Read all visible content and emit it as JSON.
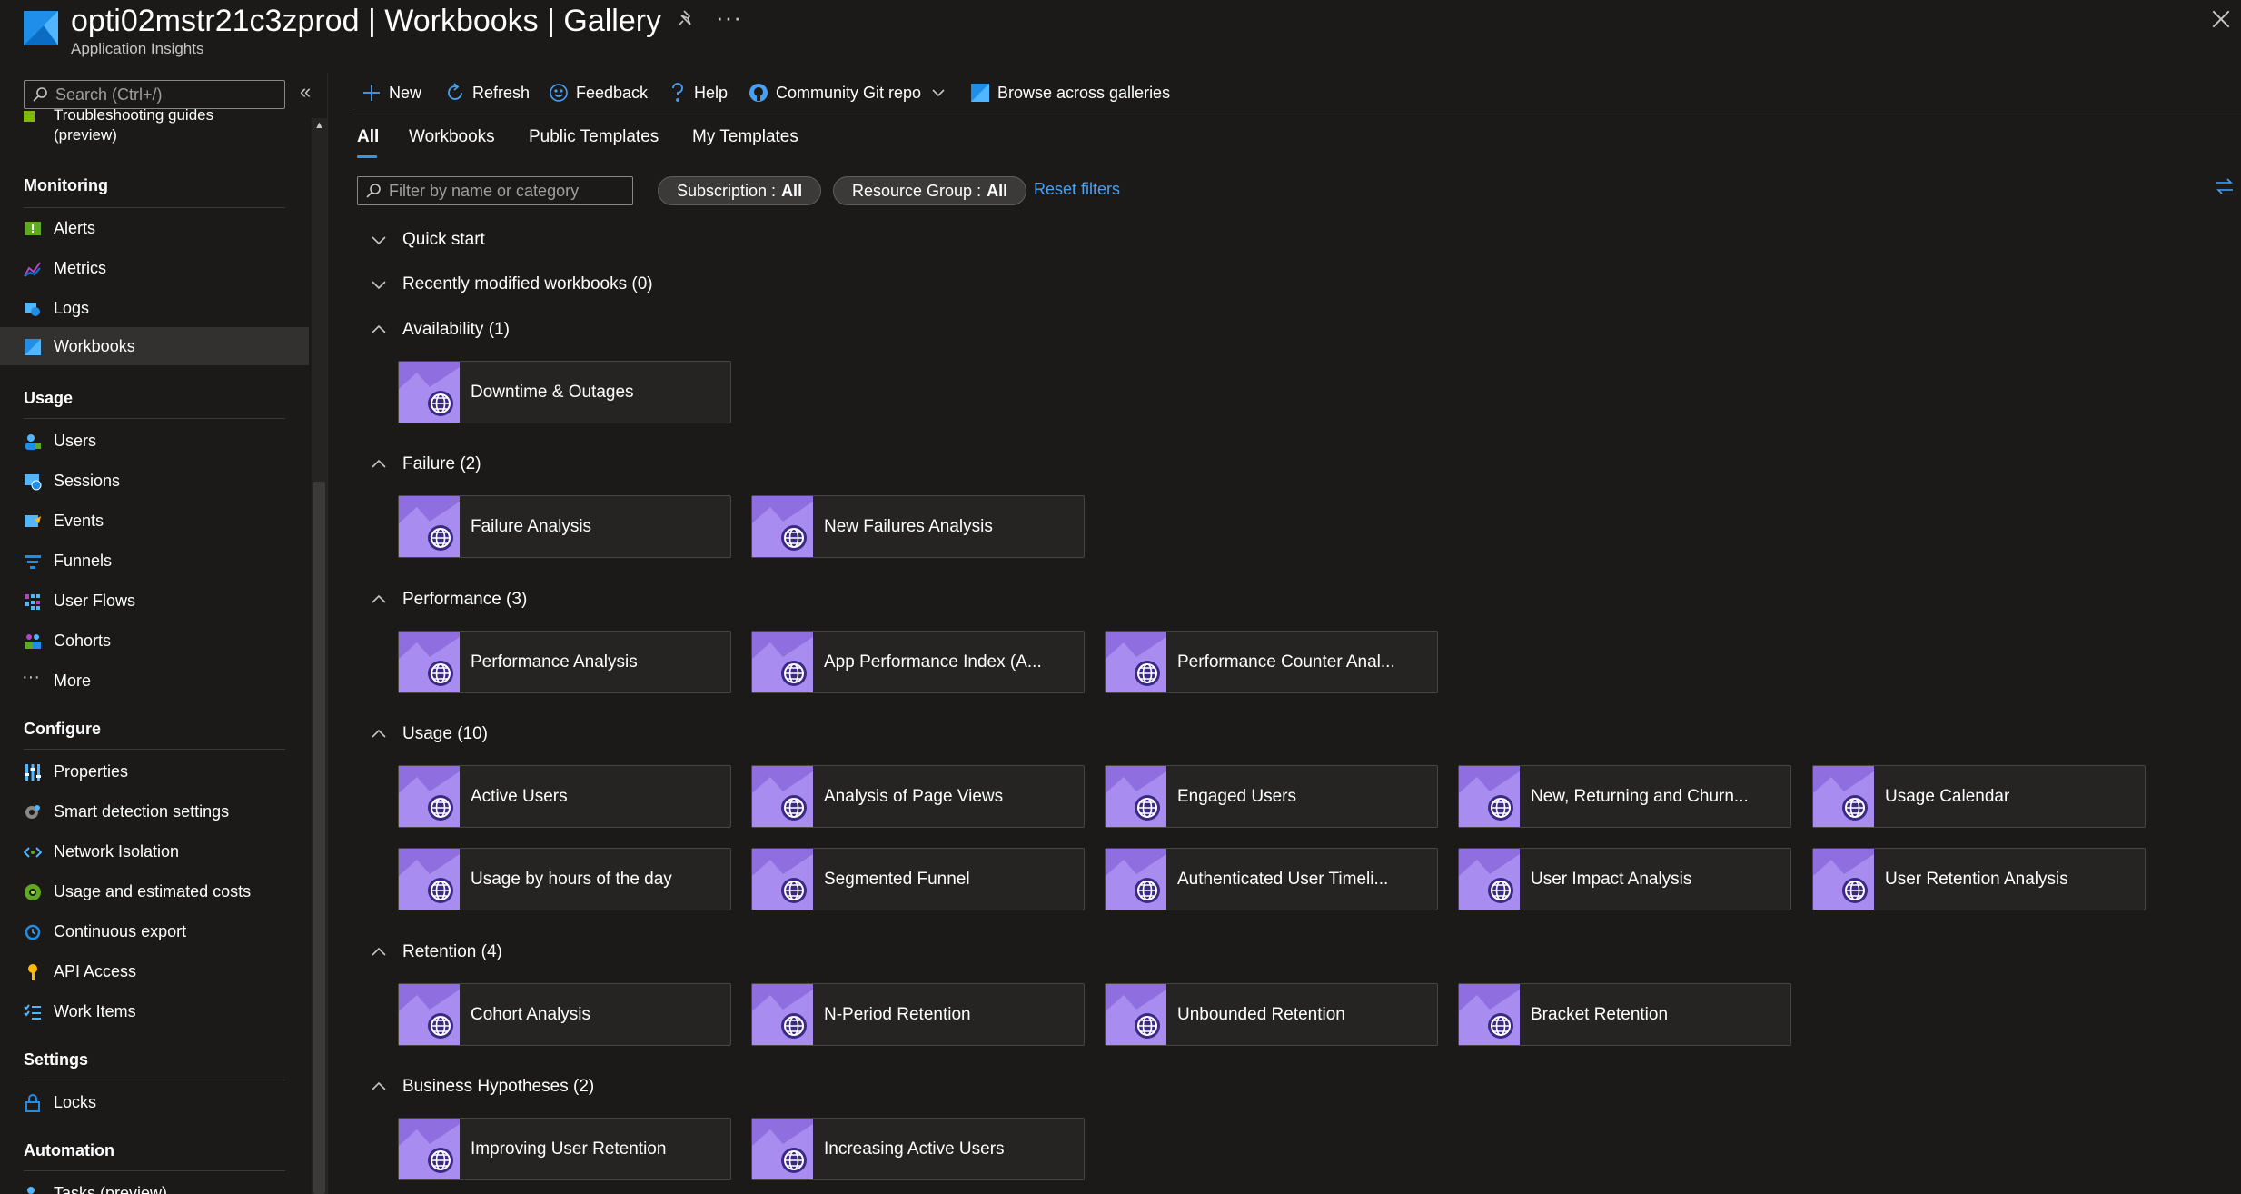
{
  "header": {
    "title": "opti02mstr21c3zprod | Workbooks | Gallery",
    "subtitle": "Application Insights",
    "more_label": "···"
  },
  "sidebar": {
    "search_placeholder": "Search (Ctrl+/)",
    "collapse_label": "«",
    "partial_top_item_line1": "Troubleshooting guides",
    "partial_top_item_line2": "(preview)",
    "sections": {
      "monitoring": "Monitoring",
      "usage": "Usage",
      "configure": "Configure",
      "settings": "Settings",
      "automation": "Automation"
    },
    "items": {
      "alerts": "Alerts",
      "metrics": "Metrics",
      "logs": "Logs",
      "workbooks": "Workbooks",
      "users": "Users",
      "sessions": "Sessions",
      "events": "Events",
      "funnels": "Funnels",
      "user_flows": "User Flows",
      "cohorts": "Cohorts",
      "more": "More",
      "properties": "Properties",
      "smart_detection": "Smart detection settings",
      "network_isolation": "Network Isolation",
      "usage_costs": "Usage and estimated costs",
      "continuous_export": "Continuous export",
      "api_access": "API Access",
      "work_items": "Work Items",
      "locks": "Locks",
      "tasks": "Tasks (preview)"
    },
    "more_dots": "···"
  },
  "toolbar": {
    "new": "New",
    "refresh": "Refresh",
    "feedback": "Feedback",
    "help": "Help",
    "community": "Community Git repo",
    "browse": "Browse across galleries"
  },
  "tabs": {
    "all": "All",
    "workbooks": "Workbooks",
    "public_templates": "Public Templates",
    "my_templates": "My Templates"
  },
  "filters": {
    "filter_placeholder": "Filter by name or category",
    "subscription_label": "Subscription :",
    "subscription_value": "All",
    "resource_group_label": "Resource Group :",
    "resource_group_value": "All",
    "reset": "Reset filters"
  },
  "groups": {
    "quick_start": "Quick start",
    "recently_modified": "Recently modified workbooks (0)",
    "availability": "Availability (1)",
    "failure": "Failure (2)",
    "performance": "Performance (3)",
    "usage": "Usage (10)",
    "retention": "Retention (4)",
    "business": "Business Hypotheses (2)"
  },
  "cards": {
    "downtime": "Downtime & Outages",
    "failure_analysis": "Failure Analysis",
    "new_failures": "New Failures Analysis",
    "perf_analysis": "Performance Analysis",
    "app_perf_index": "App Performance Index (A...",
    "perf_counter": "Performance Counter Anal...",
    "active_users": "Active Users",
    "page_views": "Analysis of Page Views",
    "engaged_users": "Engaged Users",
    "new_returning": "New, Returning and Churn...",
    "usage_calendar": "Usage Calendar",
    "usage_hours": "Usage by hours of the day",
    "segmented_funnel": "Segmented Funnel",
    "auth_user_timeline": "Authenticated User Timeli...",
    "user_impact": "User Impact Analysis",
    "user_retention": "User Retention Analysis",
    "cohort_analysis": "Cohort Analysis",
    "n_period": "N-Period Retention",
    "unbounded": "Unbounded Retention",
    "bracket": "Bracket Retention",
    "improving_retention": "Improving User Retention",
    "increasing_active": "Increasing Active Users"
  },
  "colors": {
    "background": "#1b1a19",
    "accent_blue": "#2899f5",
    "card_purple": "#8f6fe0"
  }
}
